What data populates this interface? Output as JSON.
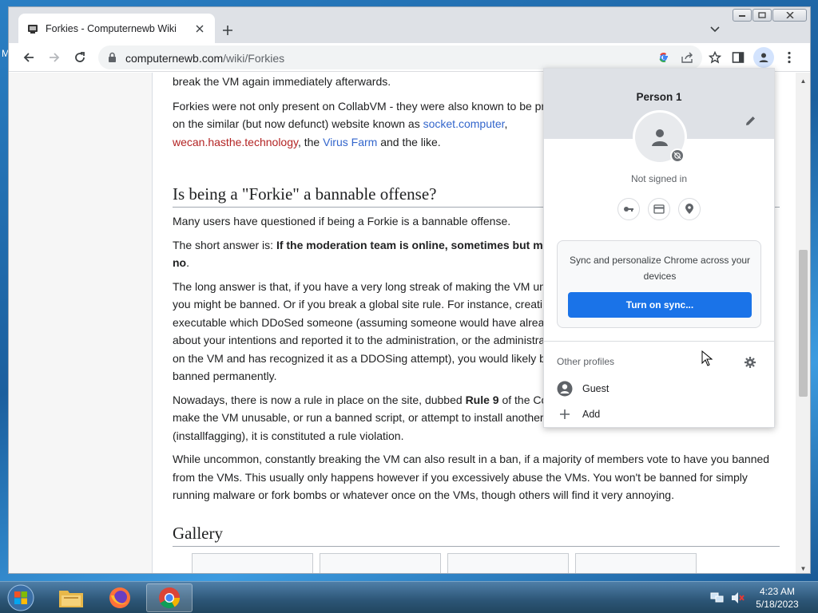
{
  "desktop": {
    "edge_text": "M"
  },
  "browser": {
    "tab": {
      "title": "Forkies - Computernewb Wiki"
    },
    "address": {
      "host": "computernewb.com",
      "path": "/wiki/Forkies"
    }
  },
  "article": {
    "p0": "break the VM again immediately afterwards.",
    "p1_a": "Forkies were not only present on CollabVM - they were also known to be pr",
    "p1_b": "on the similar (but now defunct) website known as ",
    "p1_link1": "socket.computer",
    "p1_c": ",",
    "p1_link2": "wecan.hasthe.technology",
    "p1_d": ", the ",
    "p1_link3": "Virus Farm",
    "p1_e": " and the like.",
    "h2_bannable": "Is being a \"Forkie\" a bannable offense?",
    "p2": "Many users have questioned if being a Forkie is a bannable offense.",
    "p3_a": "The short answer is: ",
    "p3_bold": "If the moderation team is online, sometimes but mo",
    "p3_bold2": "no",
    "p3_end": ".",
    "p4_l1": "The long answer is that, if you have a very long streak of making the VM un",
    "p4_l2": "you might be banned. Or if you break a global site rule. For instance, creati",
    "p4_l3": "executable which DDoSed someone (assuming someone would have alrea",
    "p4_l4": "about your intentions and reported it to the administration, or the administra",
    "p4_l5": "on the VM and has recognized it as a DDOSing attempt), you would likely b",
    "p4_l6": "banned permanently.",
    "p5_a": "Nowadays, there is now a rule in place on the site, dubbed ",
    "p5_bold": "Rule 9",
    "p5_b": " of the Co",
    "p5_l2": "make the VM unusable, or run a banned script, or attempt to install another",
    "p5_l3": "(installfagging), it is constituted a rule violation.",
    "p6_l1": "While uncommon, constantly breaking the VM can also result in a ban, if a majority of members vote to have you banned",
    "p6_l2": "from the VMs. This usually only happens however if you excessively abuse the VMs. You won't be banned for simply",
    "p6_l3": "running malware or fork bombs or whatever once on the VMs, though others will find it very annoying.",
    "h2_gallery": "Gallery"
  },
  "profile_menu": {
    "name": "Person 1",
    "status": "Not signed in",
    "sync_text": "Sync and personalize Chrome across your devices",
    "sync_button": "Turn on sync...",
    "other_profiles": "Other profiles",
    "guest": "Guest",
    "add": "Add"
  },
  "taskbar": {
    "time": "4:23 AM",
    "date": "5/18/2023"
  },
  "colors": {
    "link": "#3366cc",
    "redlink": "#b32424",
    "sync_button": "#1a73e8"
  }
}
